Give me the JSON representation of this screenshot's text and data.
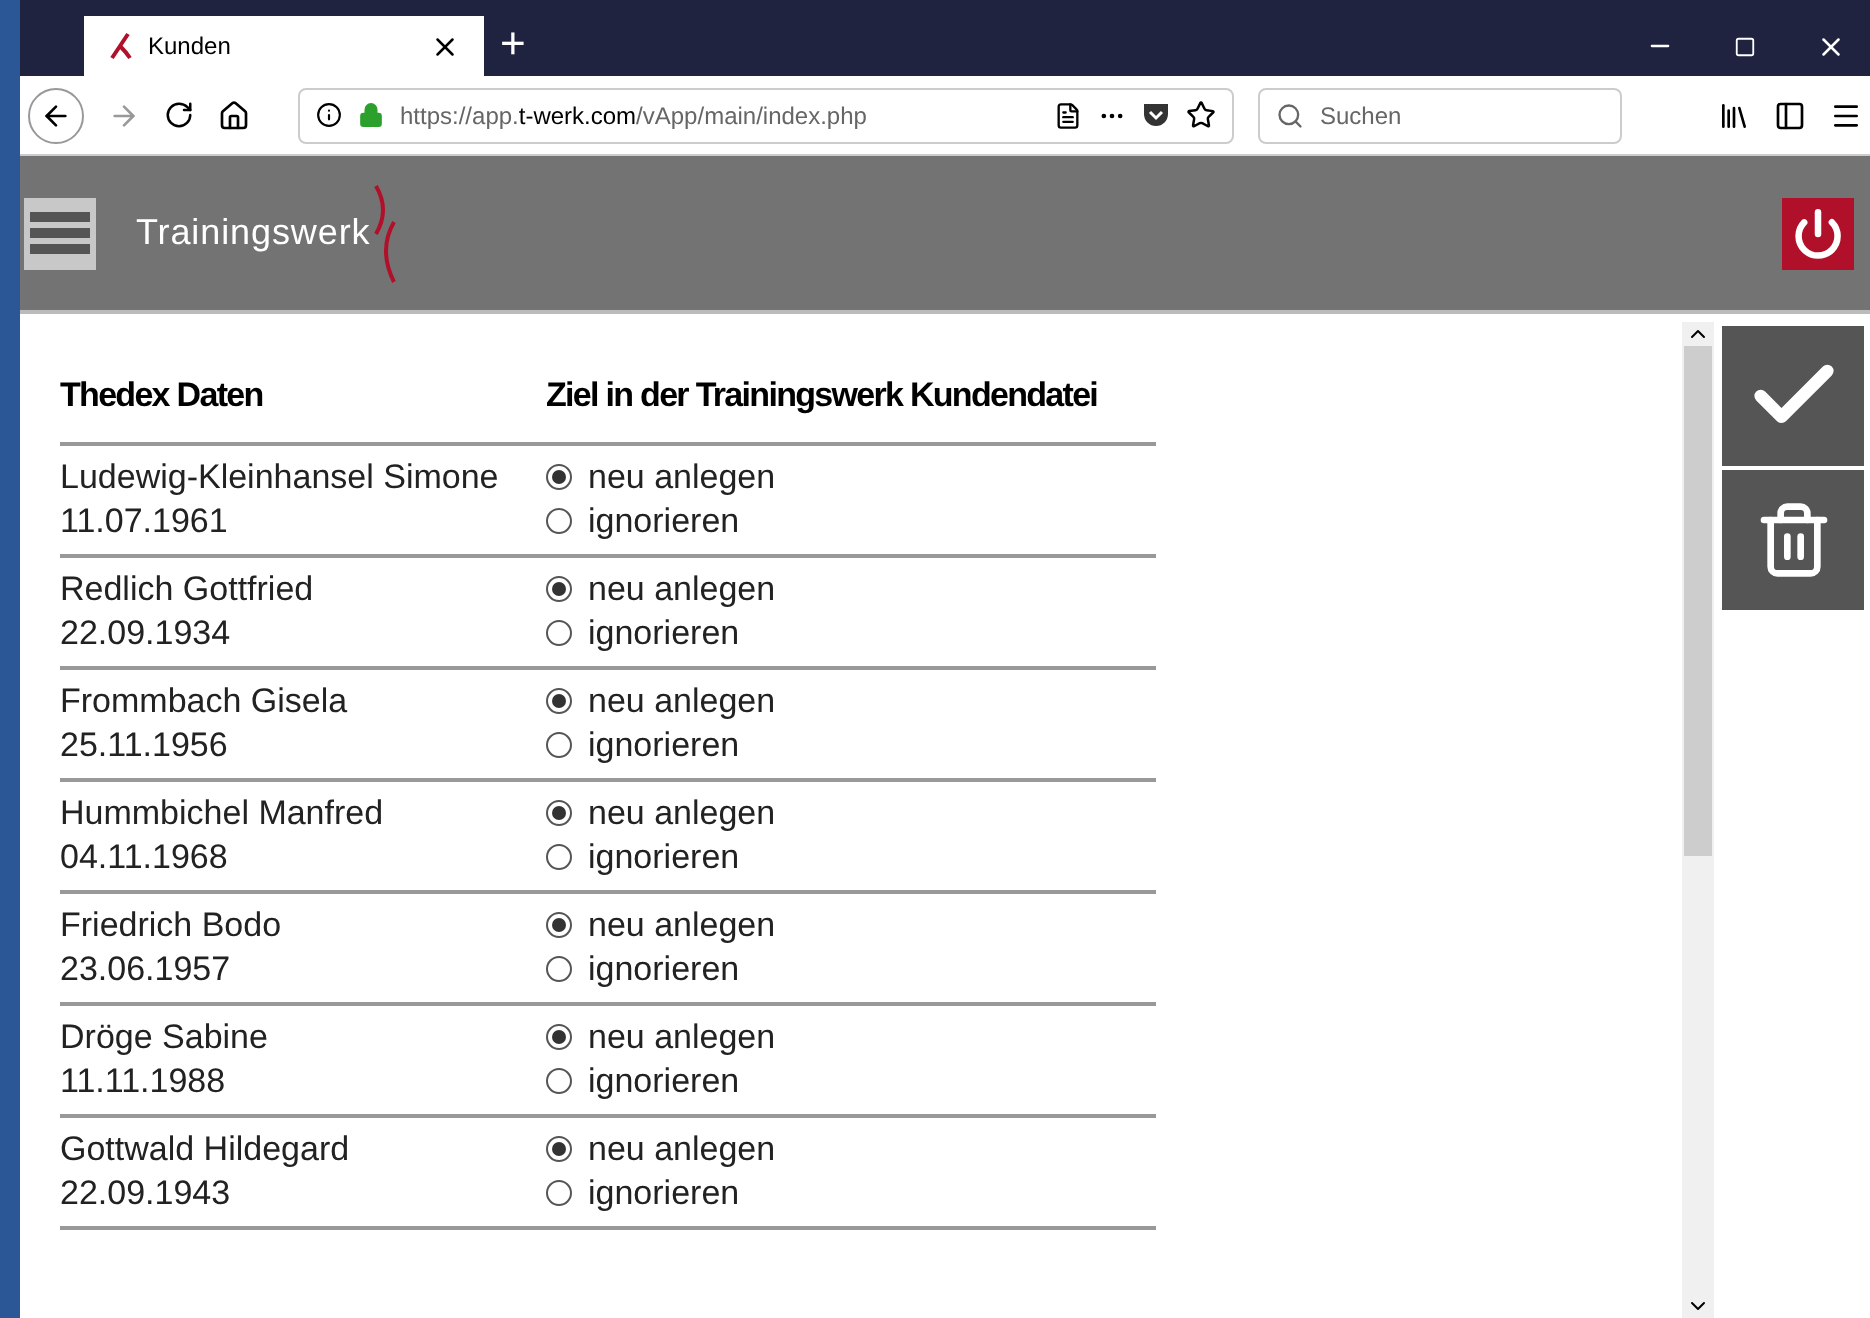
{
  "browser": {
    "tab": {
      "title": "Kunden",
      "selected": true
    },
    "new_tab": "+",
    "url": {
      "prefix": "https://app.",
      "domain": "t-werk.com",
      "path": "/vApp/main/index.php"
    },
    "search": {
      "placeholder": "Suchen"
    }
  },
  "app": {
    "logo": "Trainingswerk"
  },
  "table": {
    "columns": [
      "Thedex Daten",
      "Ziel in der Trainingswerk Kundendatei"
    ],
    "rows": [
      {
        "name": "Ludewig-Kleinhansel Simone",
        "date": "11.07.1961",
        "options": [
          {
            "label": "neu anlegen",
            "selected": true
          },
          {
            "label": "ignorieren",
            "selected": false
          }
        ]
      },
      {
        "name": "Redlich Gottfried",
        "date": "22.09.1934",
        "options": [
          {
            "label": "neu anlegen",
            "selected": true
          },
          {
            "label": "ignorieren",
            "selected": false
          }
        ]
      },
      {
        "name": "Frommbach Gisela",
        "date": "25.11.1956",
        "options": [
          {
            "label": "neu anlegen",
            "selected": true
          },
          {
            "label": "ignorieren",
            "selected": false
          }
        ]
      },
      {
        "name": "Hummbichel Manfred",
        "date": "04.11.1968",
        "options": [
          {
            "label": "neu anlegen",
            "selected": true
          },
          {
            "label": "ignorieren",
            "selected": false
          }
        ]
      },
      {
        "name": "Friedrich Bodo",
        "date": "23.06.1957",
        "options": [
          {
            "label": "neu anlegen",
            "selected": true
          },
          {
            "label": "ignorieren",
            "selected": false
          }
        ]
      },
      {
        "name": "Dröge Sabine",
        "date": "11.11.1988",
        "options": [
          {
            "label": "neu anlegen",
            "selected": true
          },
          {
            "label": "ignorieren",
            "selected": false
          }
        ]
      },
      {
        "name": "Gottwald Hildegard",
        "date": "22.09.1943",
        "options": [
          {
            "label": "neu anlegen",
            "selected": true
          },
          {
            "label": "ignorieren",
            "selected": false
          }
        ]
      }
    ]
  }
}
